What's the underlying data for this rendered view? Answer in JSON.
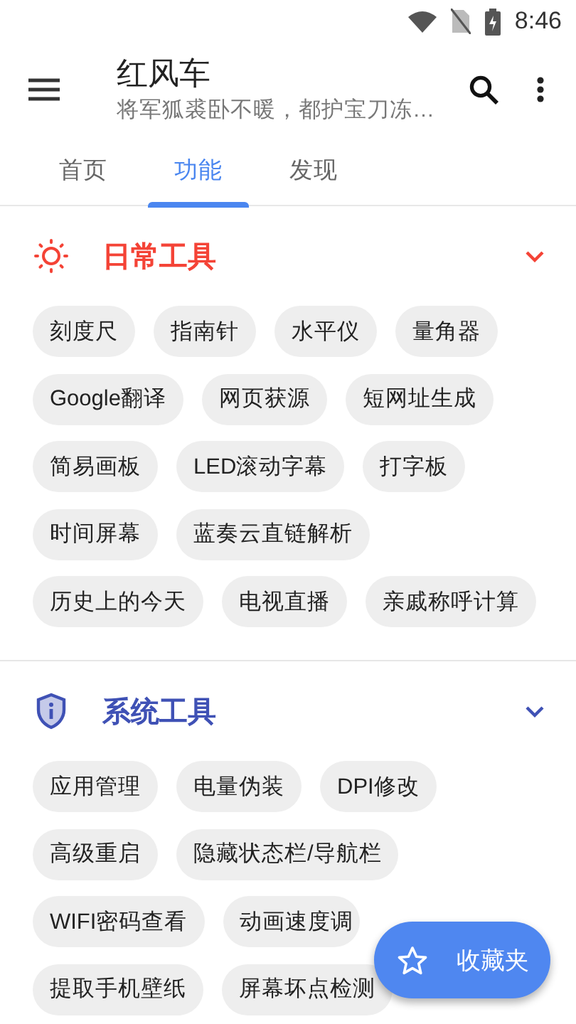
{
  "status_bar": {
    "time": "8:46"
  },
  "app_bar": {
    "title": "红风车",
    "subtitle": "将军狐裘卧不暖，都护宝刀冻…"
  },
  "tabs": [
    {
      "label": "首页",
      "selected": false
    },
    {
      "label": "功能",
      "selected": true
    },
    {
      "label": "发现",
      "selected": false
    }
  ],
  "sections": [
    {
      "title": "日常工具",
      "color": "#f44336",
      "expanded": true,
      "tools": [
        "刻度尺",
        "指南针",
        "水平仪",
        "量角器",
        "Google翻译",
        "网页获源",
        "短网址生成",
        "简易画板",
        "LED滚动字幕",
        "打字板",
        "时间屏幕",
        "蓝奏云直链解析",
        "历史上的今天",
        "电视直播",
        "亲戚称呼计算"
      ]
    },
    {
      "title": "系统工具",
      "color": "#3f51b5",
      "expanded": true,
      "tools": [
        "应用管理",
        "电量伪装",
        "DPI修改",
        "高级重启",
        "隐藏状态栏/导航栏",
        "WIFI密码查看",
        "动画速度调",
        "提取手机壁纸",
        "屏幕坏点检测"
      ]
    }
  ],
  "fab": {
    "label": "收藏夹"
  }
}
